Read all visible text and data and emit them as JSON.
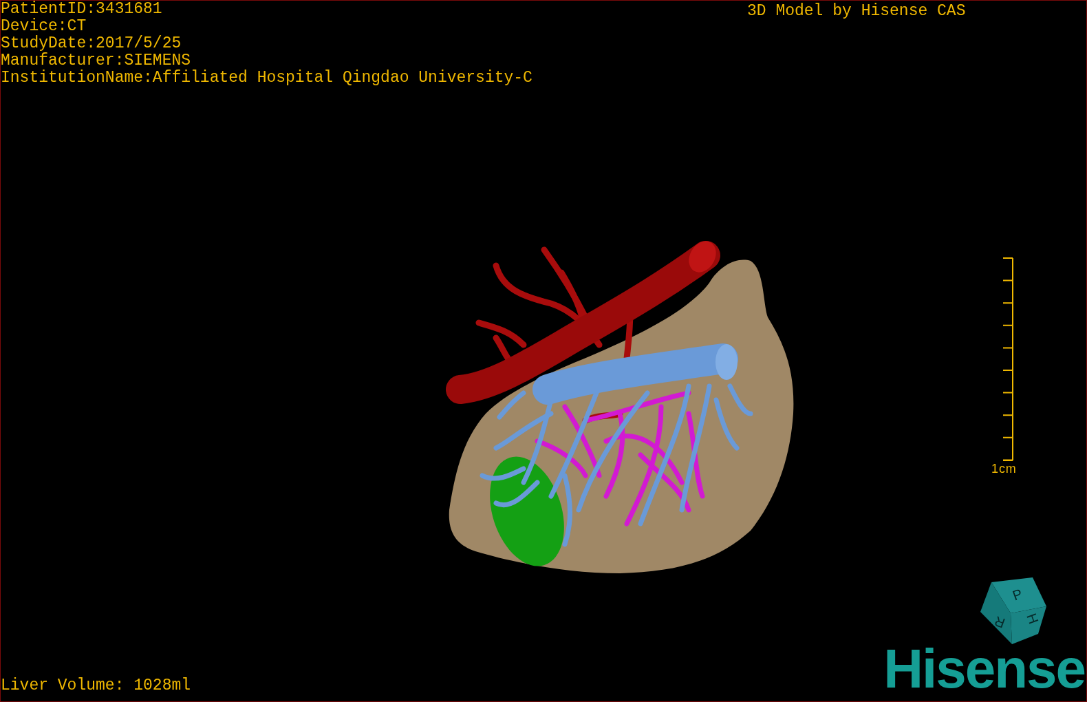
{
  "viewport": {
    "info_lines": [
      "PatientID:3431681",
      "Device:CT",
      "StudyDate:2017/5/25",
      "Manufacturer:SIEMENS",
      "InstitutionName:Affiliated Hospital Qingdao University-C"
    ],
    "title": "3D Model by Hisense CAS",
    "scale_bar": {
      "label": "1cm"
    },
    "orientation_cube": {
      "faces": [
        "P",
        "H",
        "R"
      ]
    },
    "logo": "Hisense",
    "status": "Liver Volume: 1028ml"
  }
}
